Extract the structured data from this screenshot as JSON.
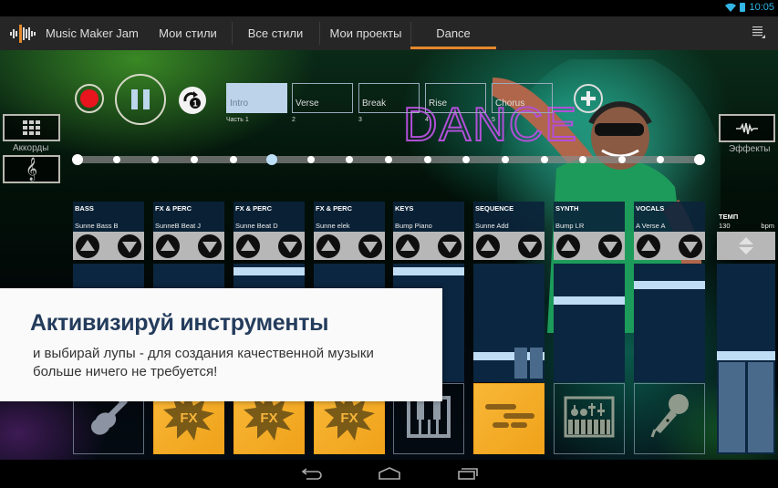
{
  "status_bar": {
    "time": "10:05"
  },
  "action_bar": {
    "app_title": "Music Maker Jam",
    "tabs": [
      {
        "label": "Мои стили",
        "selected": false
      },
      {
        "label": "Все стили",
        "selected": false
      },
      {
        "label": "Мои проекты",
        "selected": false
      },
      {
        "label": "Dance",
        "selected": true
      }
    ],
    "accent_color": "#e3892c"
  },
  "transport": {
    "record_icon": "record-icon",
    "pause_icon": "pause-icon",
    "loop_icon": "loop-once-icon",
    "loop_count": "1"
  },
  "parts": [
    {
      "label": "Intro",
      "number": "Часть 1",
      "active": true
    },
    {
      "label": "Verse",
      "number": "2",
      "active": false
    },
    {
      "label": "Break",
      "number": "3",
      "active": false
    },
    {
      "label": "Rise",
      "number": "4",
      "active": false
    },
    {
      "label": "Chorus",
      "number": "5",
      "active": false
    }
  ],
  "style_banner": {
    "text": "DANCE"
  },
  "side_buttons": {
    "chords_label": "Аккорды",
    "effects_label": "Эффекты"
  },
  "timeline": {
    "positions": 17,
    "playhead_index": 5
  },
  "channels": [
    {
      "name": "BASS",
      "loop": "Sunne Bass B",
      "level": null,
      "active": false,
      "icon": "guitar-icon"
    },
    {
      "name": "FX & PERC",
      "loop": "SunneB Beat J",
      "level": null,
      "active": true,
      "icon": "fx-burst-icon"
    },
    {
      "name": "FX & PERC",
      "loop": "Sunne Beat D",
      "level": 0.97,
      "active": true,
      "icon": "fx-burst-icon"
    },
    {
      "name": "FX & PERC",
      "loop": "Sunne elek",
      "level": null,
      "active": true,
      "icon": "fx-burst-icon"
    },
    {
      "name": "KEYS",
      "loop": "Bump Piano",
      "level": 0.97,
      "active": false,
      "icon": "piano-keys-icon"
    },
    {
      "name": "SEQUENCE",
      "loop": "Sunne Add",
      "level": 0.2,
      "active": true,
      "icon": "sequence-icon"
    },
    {
      "name": "SYNTH",
      "loop": "Bump LR",
      "level": 0.7,
      "active": false,
      "icon": "synth-keyboard-icon"
    },
    {
      "name": "VOCALS",
      "loop": "A Verse A",
      "level": 0.84,
      "active": false,
      "icon": "microphone-icon"
    }
  ],
  "tempo": {
    "label": "ТЕМП",
    "value": "130",
    "unit": "bpm",
    "level": 0.52
  },
  "promo": {
    "title": "Активизируй инструменты",
    "text": "и выбирай лупы - для создания качественной музыки больше ничего не требуется!"
  },
  "nav_bar": {
    "back": "back-icon",
    "home": "home-icon",
    "recents": "recents-icon"
  }
}
